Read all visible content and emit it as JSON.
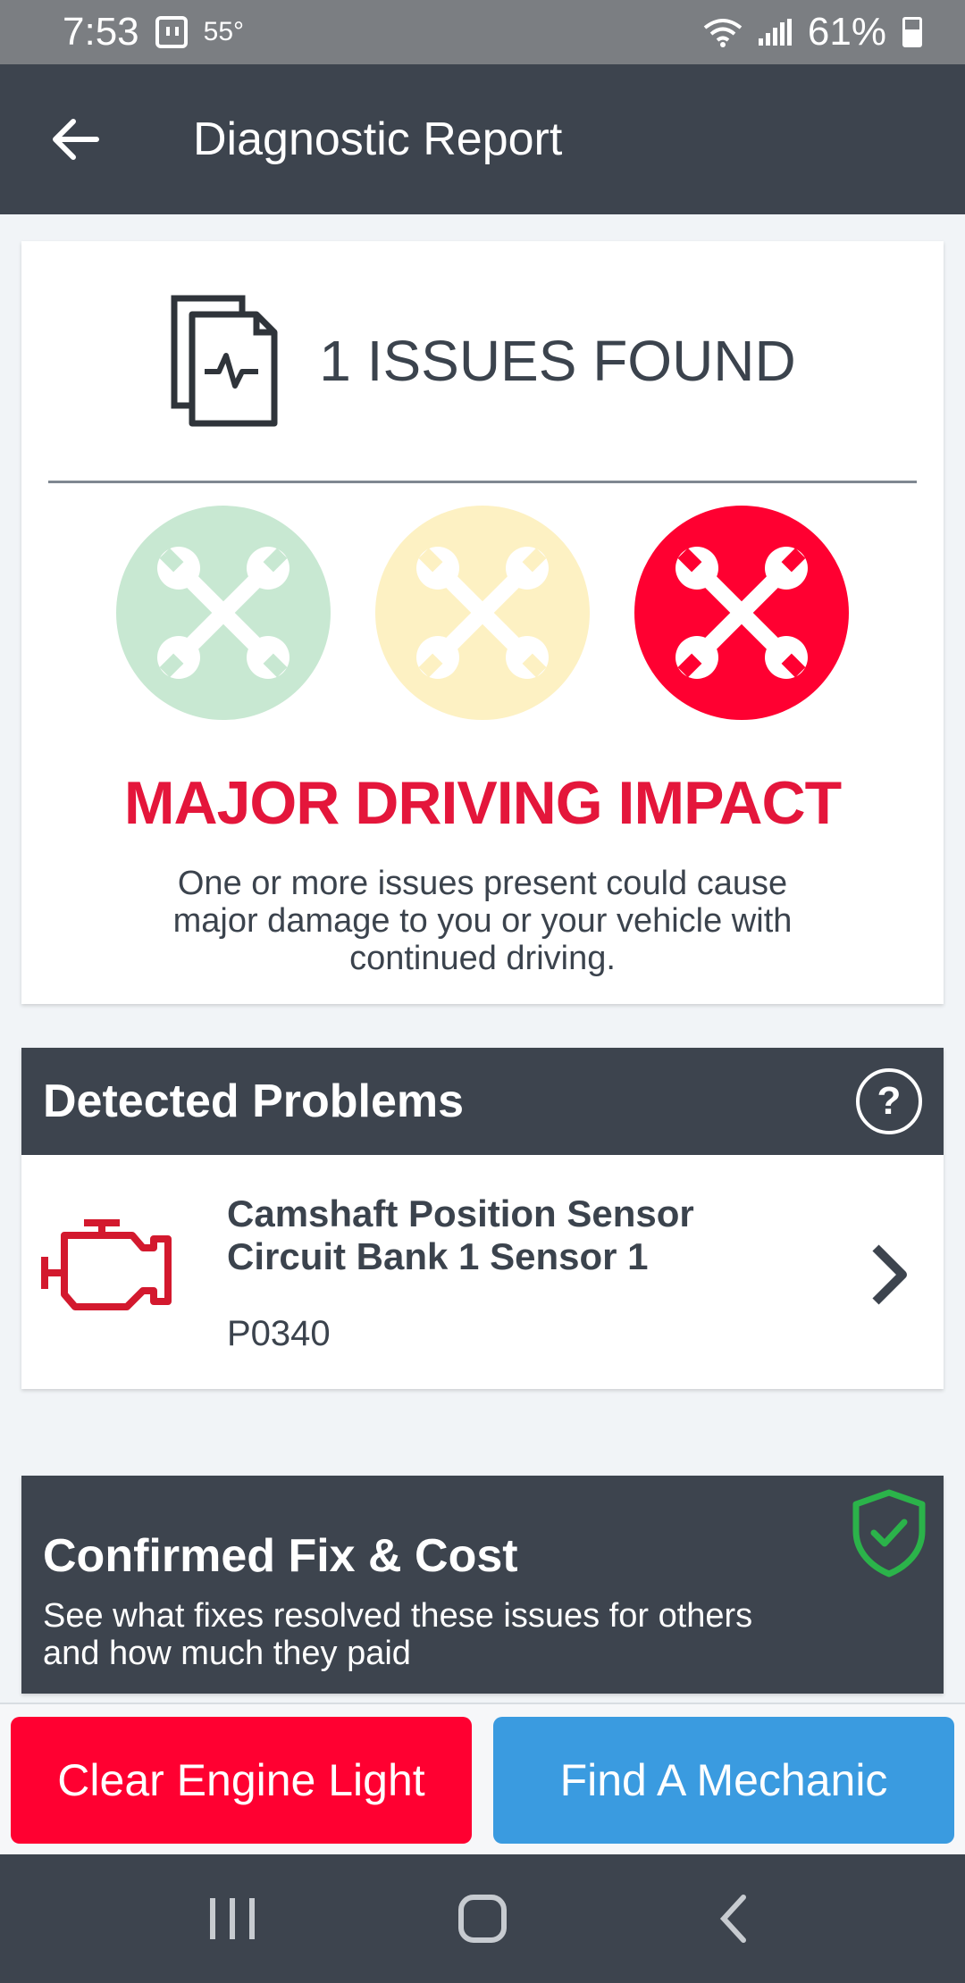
{
  "status_bar": {
    "time": "7:53",
    "temperature": "55°",
    "battery": "61%"
  },
  "app_bar": {
    "title": "Diagnostic Report"
  },
  "summary": {
    "issues_label": "1 ISSUES FOUND",
    "severity_levels": [
      {
        "name": "minor",
        "color": "#c8e8d2",
        "active": false
      },
      {
        "name": "moderate",
        "color": "#fdf1c3",
        "active": false
      },
      {
        "name": "major",
        "color": "#ff0031",
        "active": true
      }
    ],
    "impact_title": "MAJOR DRIVING IMPACT",
    "impact_description": "One or more issues present could cause major damage to you or your vehicle with continued driving."
  },
  "problems": {
    "header": "Detected Problems",
    "items": [
      {
        "name": "Camshaft Position Sensor Circuit Bank 1 Sensor 1",
        "code": "P0340",
        "icon": "check-engine-icon"
      }
    ]
  },
  "fix": {
    "header": "Confirmed Fix & Cost",
    "description": "See what fixes resolved these issues for others and how much they paid"
  },
  "actions": {
    "clear_label": "Clear Engine Light",
    "mechanic_label": "Find A Mechanic"
  },
  "colors": {
    "header_bg": "#3d444e",
    "accent_red": "#ff0031",
    "accent_blue": "#3a9be0",
    "shield_green": "#2bb34a"
  }
}
